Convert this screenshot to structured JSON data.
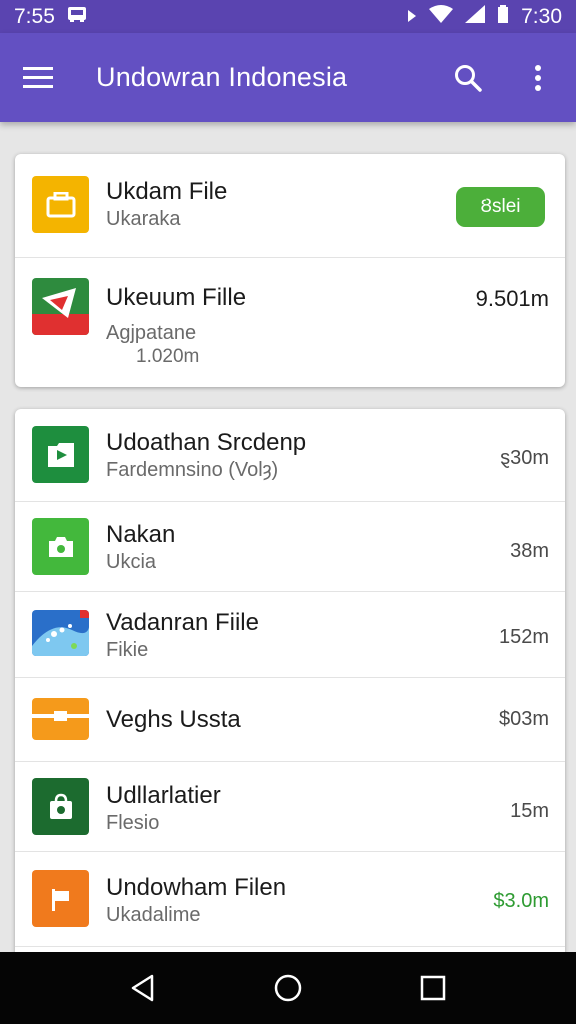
{
  "status_bar": {
    "time_left": "7:55",
    "time_right": "7:30"
  },
  "app_bar": {
    "title": "Undowran Indonesia",
    "icons": [
      "menu-icon",
      "search-icon",
      "more-vert-icon"
    ]
  },
  "card1": {
    "items": [
      {
        "name": "Ukdam File",
        "subtitle": "Ukaraka",
        "action_label": "Ȣslei",
        "icon": "folder-icon",
        "icon_color": "#f4b400"
      },
      {
        "name": "Ukeuum Fille",
        "subtitle": "Agjpatane",
        "detail": "1.020m",
        "size": "9.501m",
        "icon": "flag-icon",
        "icon_color": "#2e8b3e"
      }
    ]
  },
  "card2": {
    "items": [
      {
        "name": "Udoathan Srcdenp",
        "subtitle": "Fardemnsino (Volȝ)",
        "size": "ȿ30m",
        "icon": "play-icon",
        "icon_color": "#1e8e3e"
      },
      {
        "name": "Nakan",
        "subtitle": "Ukcia",
        "size": "38m",
        "icon": "camera-icon",
        "icon_color": "#43b83c"
      },
      {
        "name": "Vadanran Fiile",
        "subtitle": "Fikie",
        "size": "152m",
        "icon": "image-icon",
        "icon_color": "#2a6fc9"
      },
      {
        "name": "Veghs Ussta",
        "subtitle": "",
        "size": "$03m",
        "icon": "briefcase-icon",
        "icon_color": "#f59a1b"
      },
      {
        "name": "Udllarlatier",
        "subtitle": "Flesio",
        "size": "15m",
        "icon": "shopping-bag-icon",
        "icon_color": "#1c6b2f"
      },
      {
        "name": "Undowham Filen",
        "subtitle": "Ukadalime",
        "size": "$3.0m",
        "size_color": "#2e9b32",
        "icon": "flag-icon",
        "icon_color": "#f07a1d"
      }
    ]
  },
  "colors": {
    "status_bar": "#5a44b0",
    "app_bar": "#6350c2",
    "action_pill": "#4caf3a",
    "nav_bar": "#050505"
  },
  "nav_bar": {
    "icons": [
      "back-icon",
      "home-icon",
      "recents-icon"
    ]
  }
}
